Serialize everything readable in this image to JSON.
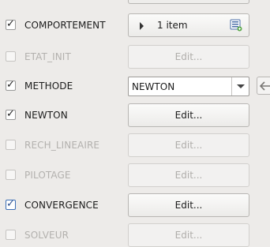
{
  "rows": [
    {
      "label": "COMPORTEMENT",
      "checked": true,
      "enabled": true,
      "control": "list",
      "value": "1 item",
      "icon": "list-add-icon"
    },
    {
      "label": "ETAT_INIT",
      "checked": false,
      "enabled": false,
      "control": "button",
      "value": "Edit..."
    },
    {
      "label": "METHODE",
      "checked": true,
      "enabled": true,
      "control": "combo",
      "value": "NEWTON"
    },
    {
      "label": "NEWTON",
      "checked": true,
      "enabled": true,
      "control": "button",
      "value": "Edit..."
    },
    {
      "label": "RECH_LINEAIRE",
      "checked": false,
      "enabled": false,
      "control": "button",
      "value": "Edit..."
    },
    {
      "label": "PILOTAGE",
      "checked": false,
      "enabled": false,
      "control": "button",
      "value": "Edit..."
    },
    {
      "label": "CONVERGENCE",
      "checked": true,
      "enabled": true,
      "control": "button",
      "value": "Edit...",
      "focused": true
    },
    {
      "label": "SOLVEUR",
      "checked": false,
      "enabled": false,
      "control": "button",
      "value": "Edit..."
    }
  ],
  "colors": {
    "background": "#edebe9",
    "focus": "#3d6fb5",
    "disabled_text": "#b3b1ae"
  },
  "icons": {
    "check": "checkmark-icon",
    "expand": "triangle-right-icon",
    "dropdown": "chevron-down-icon",
    "side": "arrow-left-icon"
  }
}
